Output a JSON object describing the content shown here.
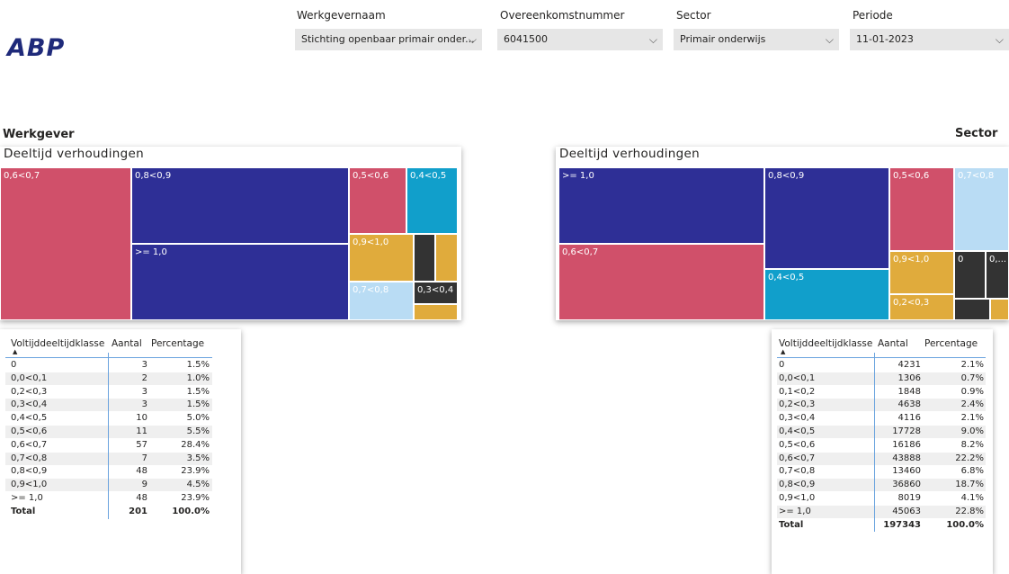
{
  "logo": "ABP",
  "slicers": [
    {
      "label": "Werkgevernaam",
      "value": "Stichting openbaar primair onder..."
    },
    {
      "label": "Overeenkomstnummer",
      "value": "6041500"
    },
    {
      "label": "Sector",
      "value": "Primair onderwijs"
    },
    {
      "label": "Periode",
      "value": "11-01-2023"
    }
  ],
  "left": {
    "section_title": "Werkgever",
    "treemap_title": "Deeltijd verhoudingen",
    "tiles": [
      {
        "label": "0,6<0,7",
        "color": "#d0506a"
      },
      {
        "label": "0,8<0,9",
        "color": "#2e2f96"
      },
      {
        "label": ">= 1,0",
        "color": "#2e2f96"
      },
      {
        "label": "0,5<0,6",
        "color": "#d0506a"
      },
      {
        "label": "0,4<0,5",
        "color": "#119fcb"
      },
      {
        "label": "0,9<1,0",
        "color": "#e0ab3c"
      },
      {
        "label": "",
        "color": "#333333"
      },
      {
        "label": "",
        "color": "#e0ab3c"
      },
      {
        "label": "0,7<0,8",
        "color": "#b9dcf4"
      },
      {
        "label": "0,3<0,4",
        "color": "#333333"
      },
      {
        "label": "",
        "color": "#e0ab3c"
      }
    ],
    "table": {
      "headers": [
        "Voltijddeeltijdklasse",
        "Aantal",
        "Percentage"
      ],
      "rows": [
        [
          "0",
          "3",
          "1.5%"
        ],
        [
          "0,0<0,1",
          "2",
          "1.0%"
        ],
        [
          "0,2<0,3",
          "3",
          "1.5%"
        ],
        [
          "0,3<0,4",
          "3",
          "1.5%"
        ],
        [
          "0,4<0,5",
          "10",
          "5.0%"
        ],
        [
          "0,5<0,6",
          "11",
          "5.5%"
        ],
        [
          "0,6<0,7",
          "57",
          "28.4%"
        ],
        [
          "0,7<0,8",
          "7",
          "3.5%"
        ],
        [
          "0,8<0,9",
          "48",
          "23.9%"
        ],
        [
          "0,9<1,0",
          "9",
          "4.5%"
        ],
        [
          ">= 1,0",
          "48",
          "23.9%"
        ]
      ],
      "total": [
        "Total",
        "201",
        "100.0%"
      ]
    }
  },
  "right": {
    "section_title": "Sector",
    "treemap_title": "Deeltijd verhoudingen",
    "tiles": [
      {
        "label": ">= 1,0",
        "color": "#2e2f96"
      },
      {
        "label": "0,8<0,9",
        "color": "#2e2f96"
      },
      {
        "label": "0,5<0,6",
        "color": "#d0506a"
      },
      {
        "label": "0,7<0,8",
        "color": "#b9dcf4"
      },
      {
        "label": "0,6<0,7",
        "color": "#d0506a"
      },
      {
        "label": "0,4<0,5",
        "color": "#119fcb"
      },
      {
        "label": "0,9<1,0",
        "color": "#e0ab3c"
      },
      {
        "label": "0",
        "color": "#333333"
      },
      {
        "label": "0,...",
        "color": "#333333"
      },
      {
        "label": "0,2<0,3",
        "color": "#e0ab3c"
      },
      {
        "label": "",
        "color": "#333333"
      },
      {
        "label": "",
        "color": "#e0ab3c"
      }
    ],
    "table": {
      "headers": [
        "Voltijddeeltijdklasse",
        "Aantal",
        "Percentage"
      ],
      "rows": [
        [
          "0",
          "4231",
          "2.1%"
        ],
        [
          "0,0<0,1",
          "1306",
          "0.7%"
        ],
        [
          "0,1<0,2",
          "1848",
          "0.9%"
        ],
        [
          "0,2<0,3",
          "4638",
          "2.4%"
        ],
        [
          "0,3<0,4",
          "4116",
          "2.1%"
        ],
        [
          "0,4<0,5",
          "17728",
          "9.0%"
        ],
        [
          "0,5<0,6",
          "16186",
          "8.2%"
        ],
        [
          "0,6<0,7",
          "43888",
          "22.2%"
        ],
        [
          "0,7<0,8",
          "13460",
          "6.8%"
        ],
        [
          "0,8<0,9",
          "36860",
          "18.7%"
        ],
        [
          "0,9<1,0",
          "8019",
          "4.1%"
        ],
        [
          ">= 1,0",
          "45063",
          "22.8%"
        ]
      ],
      "total": [
        "Total",
        "197343",
        "100.0%"
      ]
    }
  }
}
